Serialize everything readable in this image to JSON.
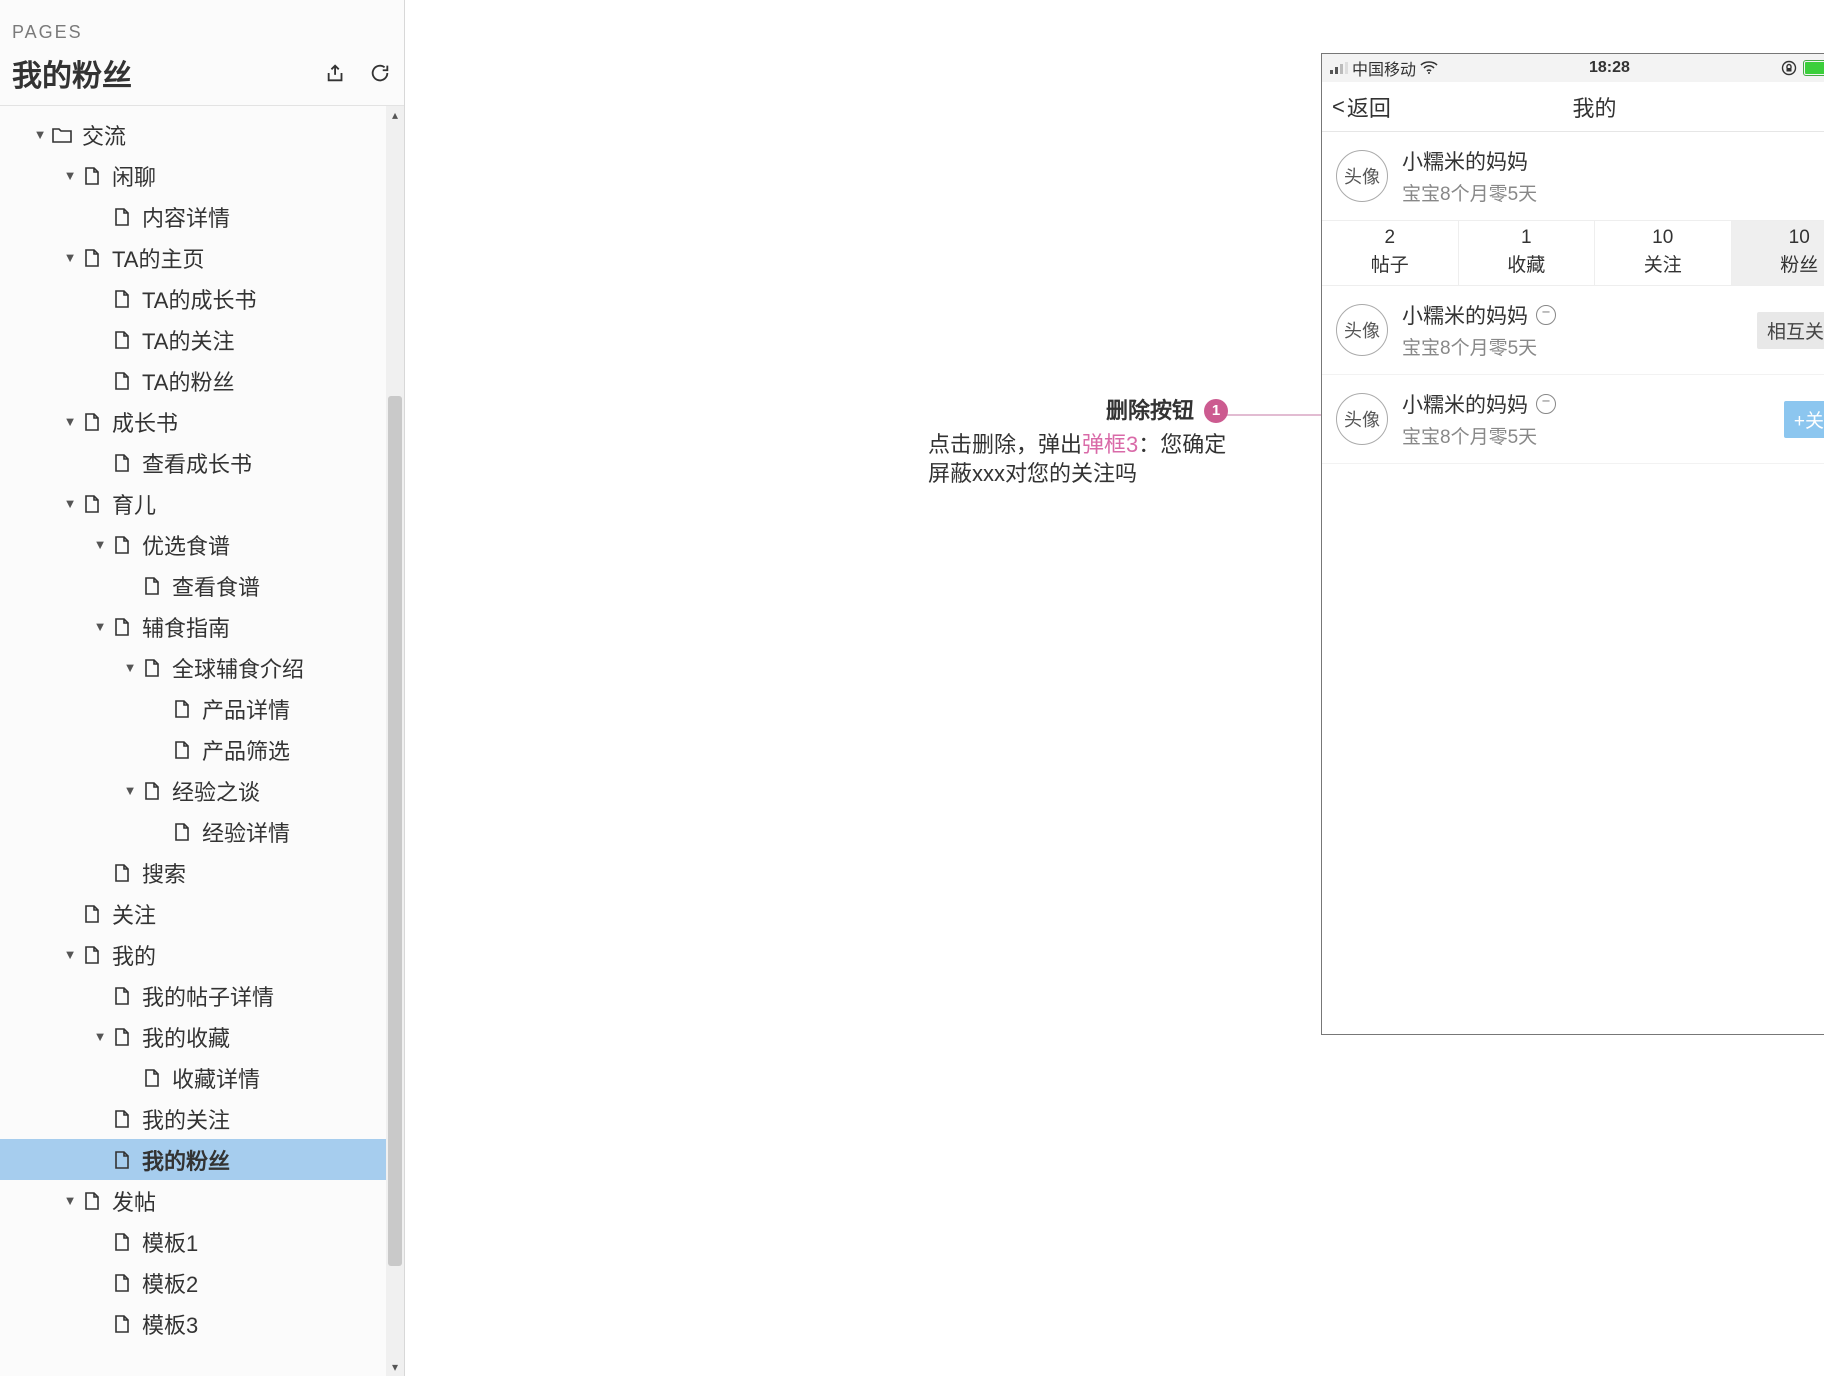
{
  "sidebar": {
    "section_label": "PAGES",
    "title": "我的粉丝",
    "tree": [
      {
        "depth": 0,
        "caret": "down",
        "icon": "folder",
        "label": "交流"
      },
      {
        "depth": 1,
        "caret": "down",
        "icon": "page",
        "label": "闲聊"
      },
      {
        "depth": 2,
        "caret": "none",
        "icon": "page",
        "label": "内容详情"
      },
      {
        "depth": 1,
        "caret": "down",
        "icon": "page",
        "label": "TA的主页"
      },
      {
        "depth": 2,
        "caret": "none",
        "icon": "page",
        "label": "TA的成长书"
      },
      {
        "depth": 2,
        "caret": "none",
        "icon": "page",
        "label": "TA的关注"
      },
      {
        "depth": 2,
        "caret": "none",
        "icon": "page",
        "label": "TA的粉丝"
      },
      {
        "depth": 1,
        "caret": "down",
        "icon": "page",
        "label": "成长书"
      },
      {
        "depth": 2,
        "caret": "none",
        "icon": "page",
        "label": "查看成长书"
      },
      {
        "depth": 1,
        "caret": "down",
        "icon": "page",
        "label": "育儿"
      },
      {
        "depth": 2,
        "caret": "down",
        "icon": "page",
        "label": "优选食谱"
      },
      {
        "depth": 3,
        "caret": "none",
        "icon": "page",
        "label": "查看食谱"
      },
      {
        "depth": 2,
        "caret": "down",
        "icon": "page",
        "label": "辅食指南"
      },
      {
        "depth": 3,
        "caret": "down",
        "icon": "page",
        "label": "全球辅食介绍"
      },
      {
        "depth": 4,
        "caret": "none",
        "icon": "page",
        "label": "产品详情"
      },
      {
        "depth": 4,
        "caret": "none",
        "icon": "page",
        "label": "产品筛选"
      },
      {
        "depth": 3,
        "caret": "down",
        "icon": "page",
        "label": "经验之谈"
      },
      {
        "depth": 4,
        "caret": "none",
        "icon": "page",
        "label": "经验详情"
      },
      {
        "depth": 2,
        "caret": "none",
        "icon": "page",
        "label": "搜索"
      },
      {
        "depth": 1,
        "caret": "none",
        "icon": "page",
        "label": "关注"
      },
      {
        "depth": 1,
        "caret": "down",
        "icon": "page",
        "label": "我的"
      },
      {
        "depth": 2,
        "caret": "none",
        "icon": "page",
        "label": "我的帖子详情"
      },
      {
        "depth": 2,
        "caret": "down",
        "icon": "page",
        "label": "我的收藏"
      },
      {
        "depth": 3,
        "caret": "none",
        "icon": "page",
        "label": "收藏详情"
      },
      {
        "depth": 2,
        "caret": "none",
        "icon": "page",
        "label": "我的关注"
      },
      {
        "depth": 2,
        "caret": "none",
        "icon": "page",
        "label": "我的粉丝",
        "selected": true
      },
      {
        "depth": 1,
        "caret": "down",
        "icon": "page",
        "label": "发帖"
      },
      {
        "depth": 2,
        "caret": "none",
        "icon": "page",
        "label": "模板1"
      },
      {
        "depth": 2,
        "caret": "none",
        "icon": "page",
        "label": "模板2"
      },
      {
        "depth": 2,
        "caret": "none",
        "icon": "page",
        "label": "模板3"
      }
    ]
  },
  "annotation": {
    "title": "删除按钮",
    "badge": "1",
    "body_pre": "点击删除，弹出",
    "body_link": "弹框3",
    "body_post": "：您确定屏蔽xxx对您的关注吗"
  },
  "mock": {
    "status": {
      "carrier": "中国移动",
      "time": "18:28"
    },
    "nav": {
      "back": "返回",
      "title": "我的"
    },
    "profile": {
      "avatar": "头像",
      "name": "小糯米的妈妈",
      "sub": "宝宝8个月零5天"
    },
    "stats": [
      {
        "num": "2",
        "label": "帖子"
      },
      {
        "num": "1",
        "label": "收藏"
      },
      {
        "num": "10",
        "label": "关注"
      },
      {
        "num": "10",
        "label": "粉丝",
        "active": true
      }
    ],
    "fans": [
      {
        "avatar": "头像",
        "name": "小糯米的妈妈",
        "sub": "宝宝8个月零5天",
        "action": "相互关注",
        "kind": "mutual"
      },
      {
        "avatar": "头像",
        "name": "小糯米的妈妈",
        "sub": "宝宝8个月零5天",
        "action": "+关注",
        "kind": "follow"
      }
    ]
  }
}
